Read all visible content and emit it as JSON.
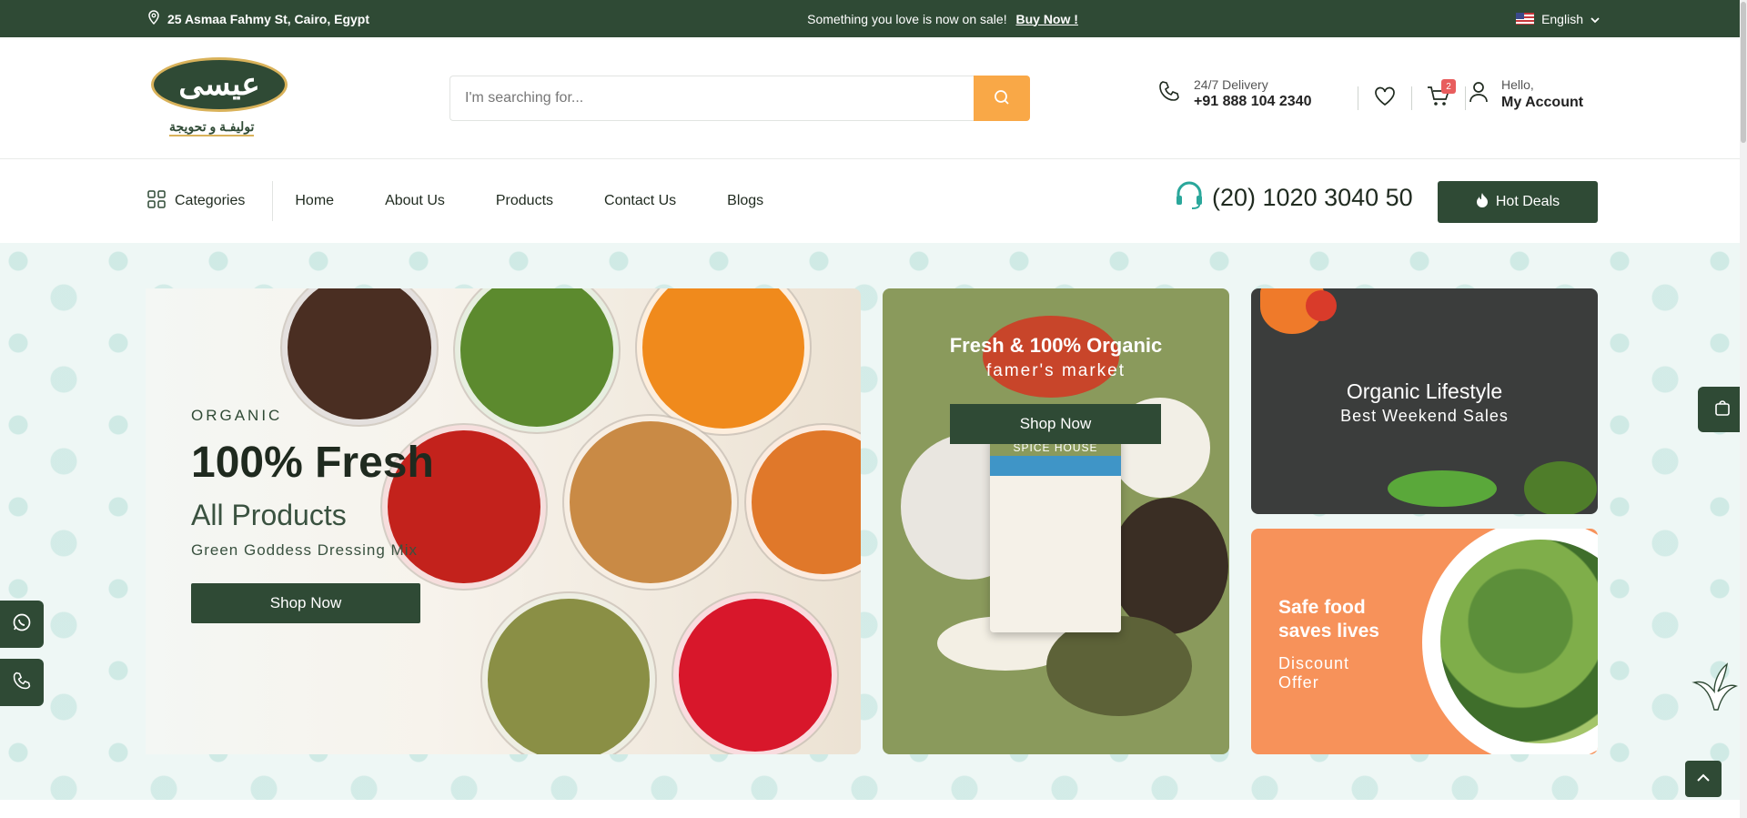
{
  "topbar": {
    "address": "25 Asmaa Fahmy St, Cairo, Egypt",
    "promo_text": "Something you love is now on sale!",
    "promo_link": "Buy Now !",
    "language": "English"
  },
  "header": {
    "logo_arabic": "عيسى",
    "logo_tagline": "توليفـة و تحويجة",
    "search_placeholder": "I'm searching for...",
    "delivery_label": "24/7 Delivery",
    "delivery_phone": "+91 888 104 2340",
    "cart_count": "2",
    "account_greeting": "Hello,",
    "account_label": "My Account"
  },
  "nav": {
    "categories": "Categories",
    "items": [
      {
        "label": "Home"
      },
      {
        "label": "About Us"
      },
      {
        "label": "Products"
      },
      {
        "label": "Contact Us"
      },
      {
        "label": "Blogs"
      }
    ],
    "hotline": "(20) 1020 3040 50",
    "hot_deals": "Hot Deals"
  },
  "hero": {
    "main": {
      "eyebrow": "ORGANIC",
      "title": "100% Fresh",
      "subtitle": "All Products",
      "description": "Green Goddess Dressing Mix",
      "button": "Shop Now"
    },
    "middle": {
      "title": "Fresh & 100% Organic",
      "subtitle": "famer's market",
      "button": "Shop Now",
      "package_brand": "SPICE HOUSE"
    },
    "right_top": {
      "title": "Organic Lifestyle",
      "subtitle": "Best Weekend Sales"
    },
    "right_bottom": {
      "title_line1": "Safe food",
      "title_line2": "saves lives",
      "sub_line1": "Discount",
      "sub_line2": "Offer"
    }
  },
  "colors": {
    "brand_green": "#2f4a35",
    "accent_orange": "#f9a847",
    "badge_red": "#e85d5d"
  }
}
